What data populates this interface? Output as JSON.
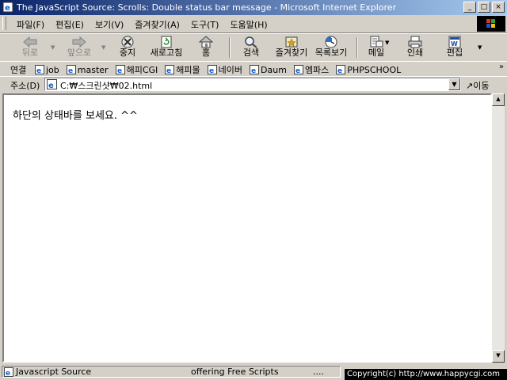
{
  "window": {
    "title": "The JavaScript Source: Scrolls: Double status bar message - Microsoft Internet Explorer",
    "minimize": "_",
    "maximize": "□",
    "close": "×"
  },
  "menu": [
    "파일(F)",
    "편집(E)",
    "보기(V)",
    "즐겨찾기(A)",
    "도구(T)",
    "도움말(H)"
  ],
  "toolbar": {
    "back": "뒤로",
    "forward": "앞으로",
    "stop": "중지",
    "refresh": "새로고침",
    "home": "홈",
    "search": "검색",
    "favorites": "즐겨찾기",
    "history": "목록보기",
    "mail": "메일",
    "print": "인쇄",
    "edit": "편집"
  },
  "links": {
    "label": "연결",
    "items": [
      "job",
      "master",
      "해피CGI",
      "해피몰",
      "네이버",
      "Daum",
      "엠파스",
      "PHPSCHOOL"
    ],
    "more": "»"
  },
  "address": {
    "label": "주소(D)",
    "value": "C:₩스크린샷₩02.html",
    "go_label": "이동"
  },
  "content": {
    "text": "하단의 상태바를 보세요. ^^"
  },
  "status": {
    "left": "Javascript Source",
    "middle": "offering Free Scripts",
    "dots": "....",
    "copyright": "Copyright(c) http://www.happycgi.com"
  },
  "icons": [
    "ie-page-icon",
    "back-icon",
    "forward-icon",
    "stop-icon",
    "refresh-icon",
    "home-icon",
    "search-icon",
    "favorites-icon",
    "history-icon",
    "mail-icon",
    "print-icon",
    "edit-icon",
    "windows-logo-icon"
  ]
}
